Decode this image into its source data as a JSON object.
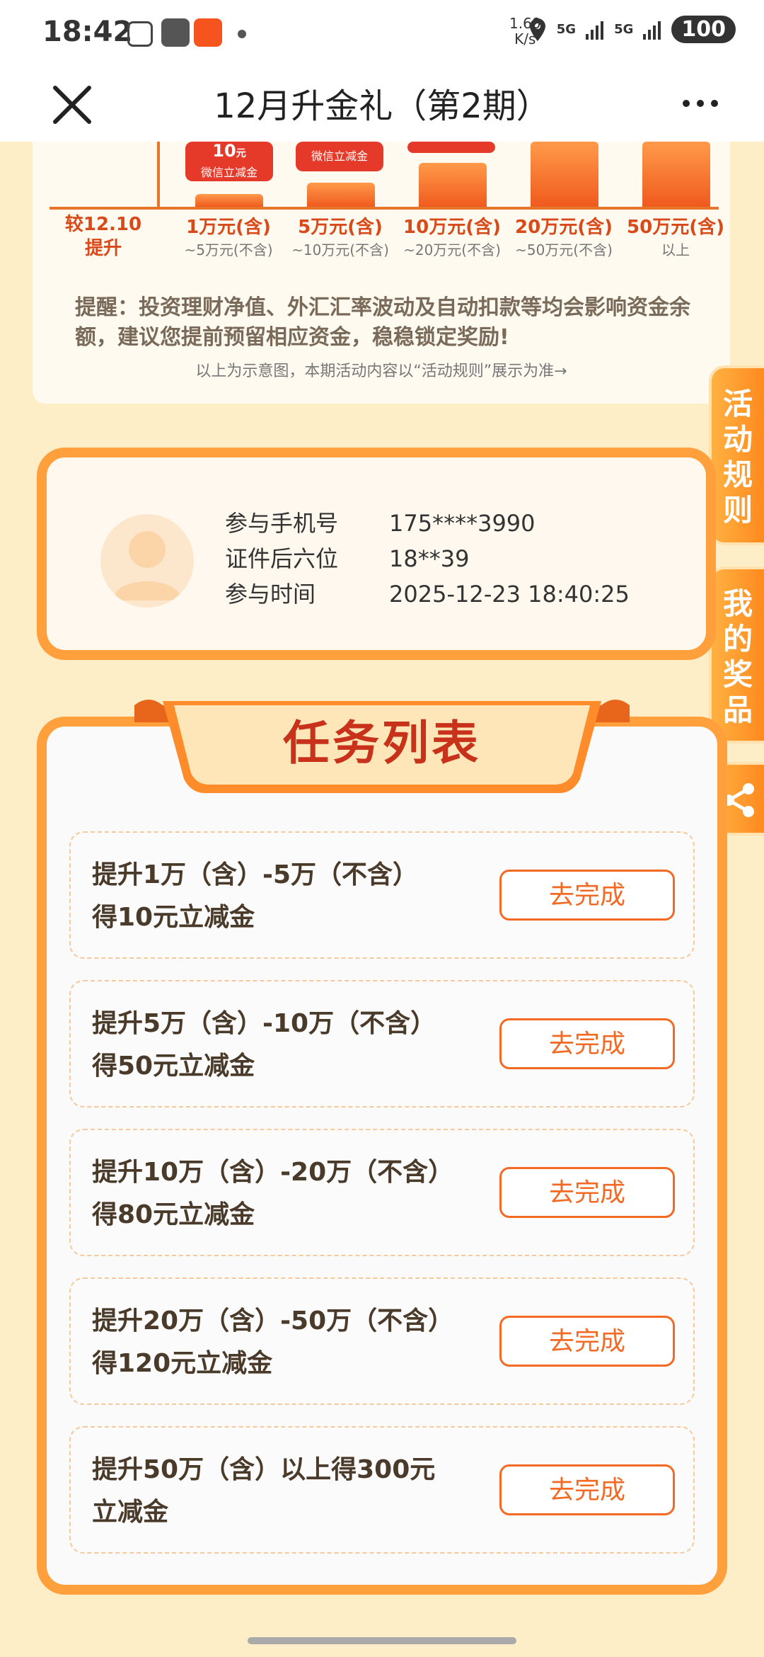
{
  "status_bar": {
    "time": "18:42",
    "net_speed_value": "1.60",
    "net_speed_unit": "K/s",
    "net1": "5G",
    "net2": "5G",
    "battery": "100"
  },
  "nav": {
    "title": "12月升金礼（第2期）"
  },
  "chart": {
    "coupon_value": "10",
    "coupon_unit": "元",
    "coupon_label": "微信立减金",
    "first_label": "较12.10提升",
    "tiers": [
      {
        "main": "1万元(含)",
        "sub": "~5万元(不含)"
      },
      {
        "main": "5万元(含)",
        "sub": "~10万元(不含)"
      },
      {
        "main": "10万元(含)",
        "sub": "~20万元(不含)"
      },
      {
        "main": "20万元(含)",
        "sub": "~50万元(不含)"
      },
      {
        "main": "50万元(含)",
        "sub": "以上"
      }
    ],
    "tip": "提醒：投资理财净值、外汇汇率波动及自动扣款等均会影响资金余额，建议您提前预留相应资金，稳稳锁定奖励!",
    "note": "以上为示意图，本期活动内容以“活动规则”展示为准→"
  },
  "side_tabs": {
    "rules": "活动规则",
    "prizes": "我的奖品"
  },
  "user": {
    "rows": [
      {
        "label": "参与手机号",
        "value": "175****3990"
      },
      {
        "label": "证件后六位",
        "value": "18**39"
      },
      {
        "label": "参与时间",
        "value": "2025-12-23 18:40:25"
      }
    ]
  },
  "tasks": {
    "title": "任务列表",
    "items": [
      {
        "line1": "提升1万（含）-5万（不含）",
        "line2": "得10元立减金",
        "button": "去完成"
      },
      {
        "line1": "提升5万（含）-10万（不含）",
        "line2": "得50元立减金",
        "button": "去完成"
      },
      {
        "line1": "提升10万（含）-20万（不含）",
        "line2": "得80元立减金",
        "button": "去完成"
      },
      {
        "line1": "提升20万（含）-50万（不含）",
        "line2": "得120元立减金",
        "button": "去完成"
      },
      {
        "line1": "提升50万（含）以上得300元",
        "line2": "立减金",
        "button": "去完成"
      }
    ]
  },
  "colors": {
    "accent": "#f26a24",
    "card_border": "#ffa03c",
    "background": "#fdeec8"
  }
}
